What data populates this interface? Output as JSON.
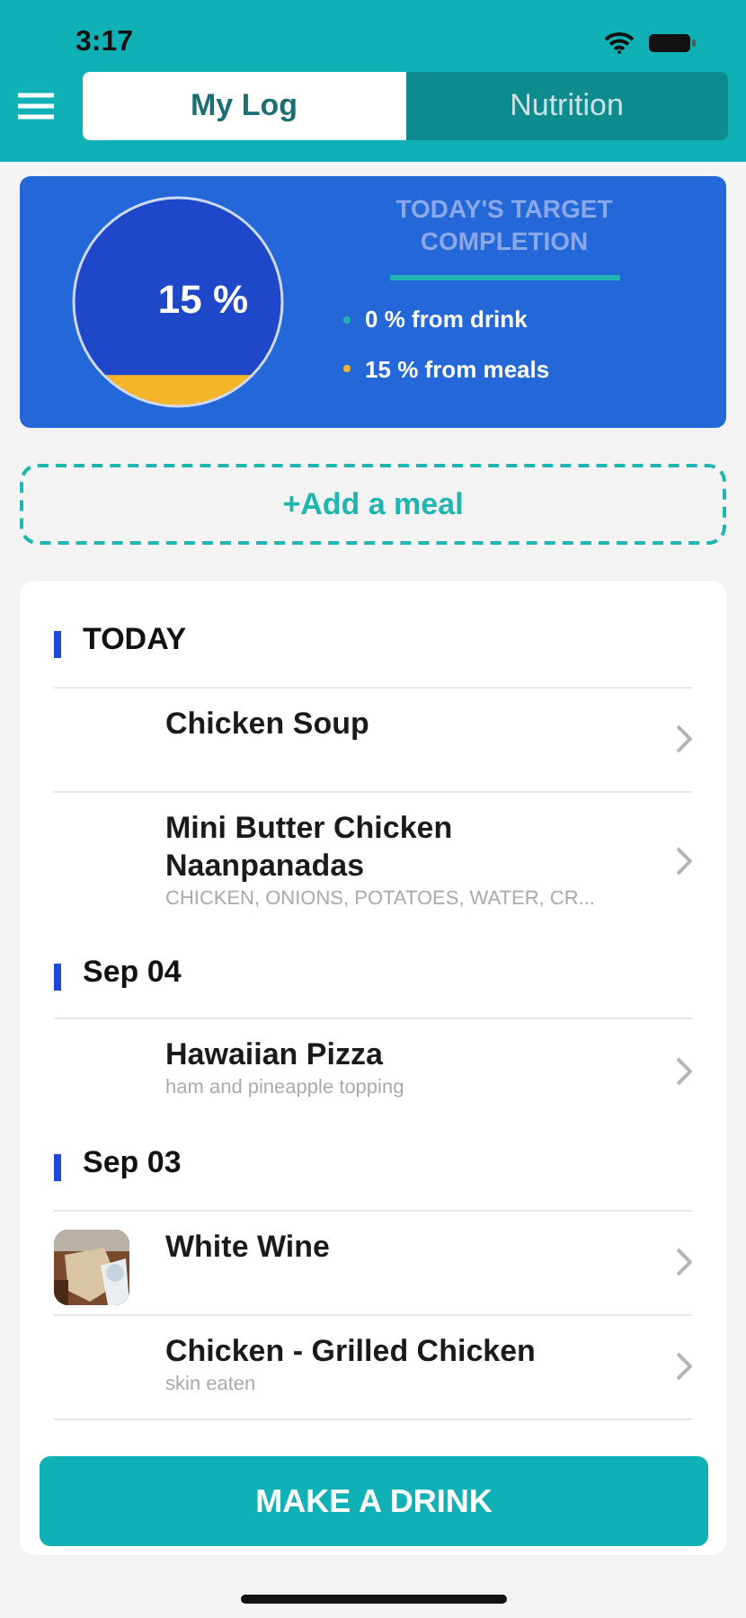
{
  "status_bar": {
    "time": "3:17"
  },
  "tabs": [
    {
      "label": "My Log",
      "selected": true
    },
    {
      "label": "Nutrition",
      "selected": false
    }
  ],
  "summary": {
    "value": "15 %",
    "title": "TODAY'S TARGET COMPLETION",
    "legend": [
      {
        "label": "0 % from drink",
        "color": "#1fb5b0"
      },
      {
        "label": "15 % from meals",
        "color": "#f5b52a"
      }
    ]
  },
  "add_button": "+Add a meal",
  "sections": [
    {
      "title": "TODAY",
      "items": [
        {
          "name": "Chicken Soup"
        },
        {
          "name": "Mini Butter Chicken Naanpanadas",
          "detail": "CHICKEN, ONIONS, POTATOES, WATER, CR..."
        }
      ]
    },
    {
      "title": "Sep 04",
      "items": [
        {
          "name": "Hawaiian Pizza",
          "detail": "ham and pineapple topping"
        }
      ]
    },
    {
      "title": "Sep 03",
      "items": [
        {
          "name": "White Wine",
          "kind": "picture"
        },
        {
          "name": "Chicken - Grilled Chicken",
          "detail": "skin eaten"
        }
      ]
    }
  ],
  "action_button": "MAKE A DRINK"
}
